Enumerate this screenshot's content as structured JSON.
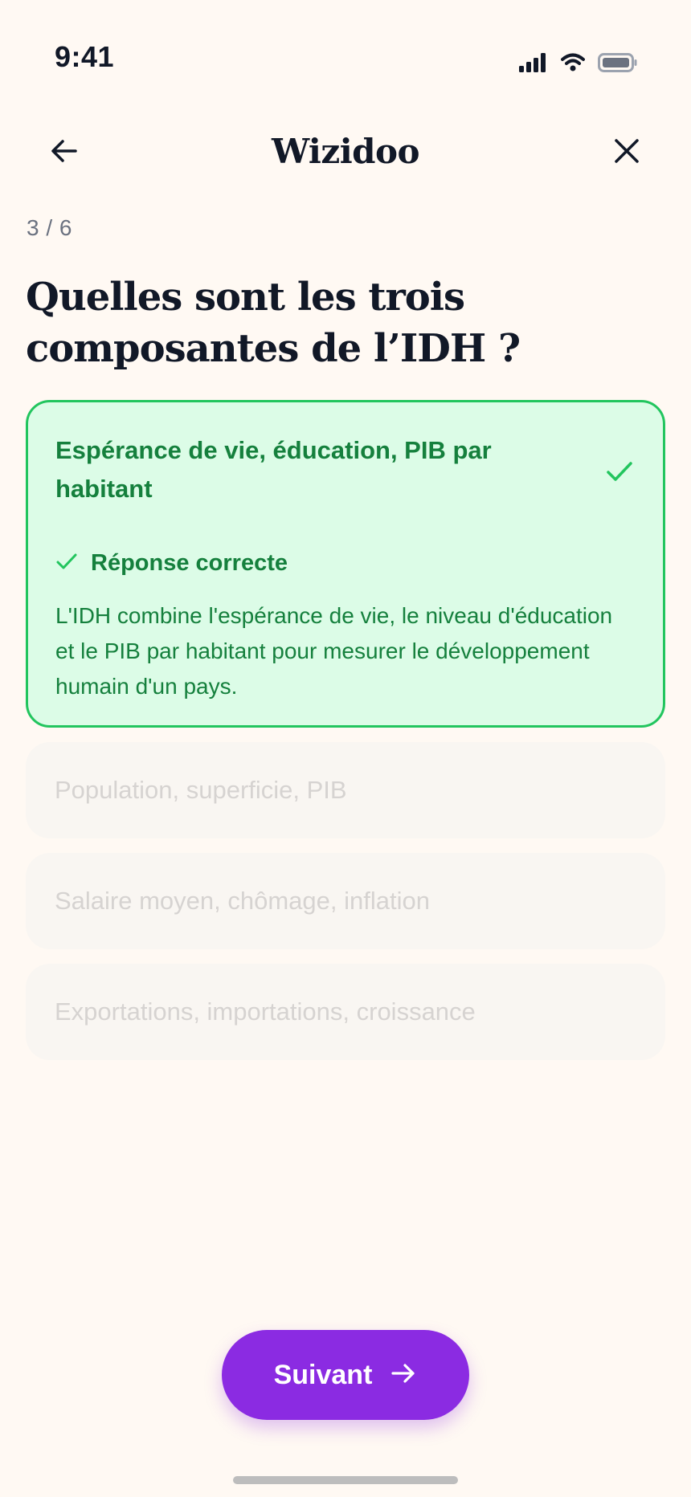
{
  "status_bar": {
    "time": "9:41",
    "icons": [
      "cellular-signal-icon",
      "wifi-icon",
      "battery-icon"
    ]
  },
  "header": {
    "title": "Wizidoo",
    "back_icon": "arrow-left-icon",
    "close_icon": "close-icon"
  },
  "progress": {
    "label": "3 / 6",
    "current": 3,
    "total": 6
  },
  "question": "Quelles sont les trois composantes de l’IDH ?",
  "options": [
    {
      "label": "Espérance de vie, éducation, PIB par habitant",
      "state": "correct-selected"
    },
    {
      "label": "Population, superficie, PIB",
      "state": "disabled"
    },
    {
      "label": "Salaire moyen, chômage, inflation",
      "state": "disabled"
    },
    {
      "label": "Exportations, importations, croissance",
      "state": "disabled"
    }
  ],
  "feedback": {
    "title": "Réponse correcte",
    "explanation": "L'IDH combine l'espérance de vie, le niveau d'éducation et le PIB par habitant pour mesurer le développement humain d'un pays.",
    "icon": "check-icon"
  },
  "next_button": {
    "label": "Suivant",
    "icon": "arrow-right-icon"
  },
  "colors": {
    "background": "#FFF9F3",
    "correct_bg": "#DCFCE7",
    "correct_border": "#22C55E",
    "correct_text": "#15803D",
    "disabled_bg": "#F9F6F2",
    "disabled_text": "#D6D3D1",
    "primary": "#8B2BE2"
  }
}
